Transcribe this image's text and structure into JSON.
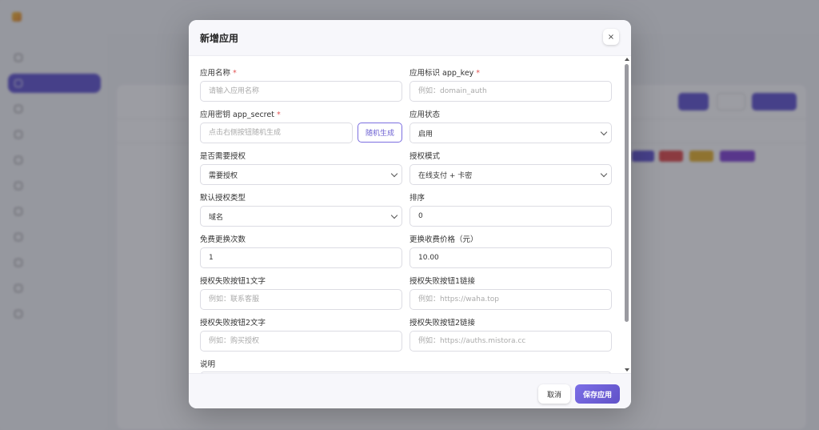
{
  "colors": {
    "accent": "#6b5fd2",
    "required": "#e25555",
    "overlay": "rgba(20,22,35,0.42)"
  },
  "modal": {
    "title": "新增应用",
    "close_icon": "×",
    "required_mark": "*",
    "fields": {
      "app_name": {
        "label": "应用名称",
        "required": true,
        "placeholder": "请输入应用名称",
        "value": ""
      },
      "app_key": {
        "label": "应用标识 app_key",
        "required": true,
        "placeholder": "例如：domain_auth",
        "value": ""
      },
      "app_secret": {
        "label": "应用密钥 app_secret",
        "required": true,
        "placeholder": "点击右侧按钮随机生成",
        "value": "",
        "generate_button": "随机生成"
      },
      "app_status": {
        "label": "应用状态",
        "value": "启用"
      },
      "need_auth": {
        "label": "是否需要授权",
        "value": "需要授权"
      },
      "auth_mode": {
        "label": "授权模式",
        "value": "在线支付 + 卡密"
      },
      "default_auth_type": {
        "label": "默认授权类型",
        "value": "域名"
      },
      "sort": {
        "label": "排序",
        "value": "0"
      },
      "free_change_count": {
        "label": "免费更换次数",
        "value": "1"
      },
      "change_fee": {
        "label": "更换收费价格（元）",
        "value": "10.00"
      },
      "fail_btn1_text": {
        "label": "授权失败按钮1文字",
        "placeholder": "例如：联系客服",
        "value": ""
      },
      "fail_btn1_link": {
        "label": "授权失败按钮1链接",
        "placeholder": "例如：https://waha.top",
        "value": ""
      },
      "fail_btn2_text": {
        "label": "授权失败按钮2文字",
        "placeholder": "例如：购买授权",
        "value": ""
      },
      "fail_btn2_link": {
        "label": "授权失败按钮2链接",
        "placeholder": "例如：https://auths.mistora.cc",
        "value": ""
      },
      "description": {
        "label": "说明"
      }
    },
    "footer": {
      "cancel_label": "取消",
      "save_label": "保存应用"
    }
  }
}
